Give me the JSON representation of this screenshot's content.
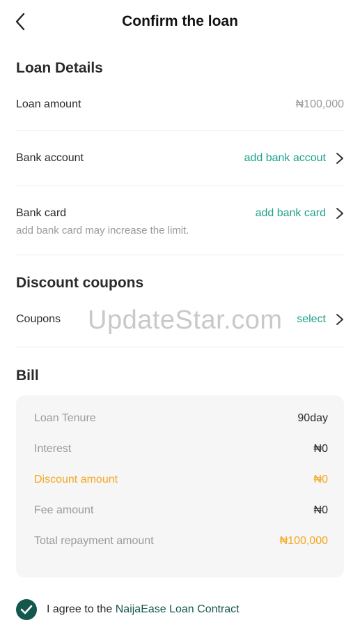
{
  "header": {
    "title": "Confirm the loan",
    "back_icon": "chevron-left-icon"
  },
  "loan_details": {
    "title": "Loan Details",
    "loan_amount_label": "Loan amount",
    "loan_amount_value": "₦100,000",
    "bank_account_label": "Bank account",
    "bank_account_action": "add bank accout",
    "bank_card_label": "Bank card",
    "bank_card_action": "add bank card",
    "bank_card_hint": "add bank card may increase the limit."
  },
  "coupons": {
    "title": "Discount coupons",
    "label": "Coupons",
    "action": "select"
  },
  "watermark": "UpdateStar.com",
  "bill": {
    "title": "Bill",
    "rows": [
      {
        "label": "Loan Tenure",
        "value": "90day"
      },
      {
        "label": "Interest",
        "value": "₦0"
      },
      {
        "label": "Discount amount",
        "value": "₦0"
      },
      {
        "label": "Fee amount",
        "value": "₦0"
      },
      {
        "label": "Total repayment amount",
        "value": "₦100,000"
      }
    ]
  },
  "agreement": {
    "prefix": "I agree to the ",
    "link": "NaijaEase Loan Contract",
    "checked": true
  },
  "colors": {
    "accent": "#1ea18d",
    "dark_green": "#15574d",
    "orange": "#f5a71d",
    "muted": "#9a9a9a"
  }
}
